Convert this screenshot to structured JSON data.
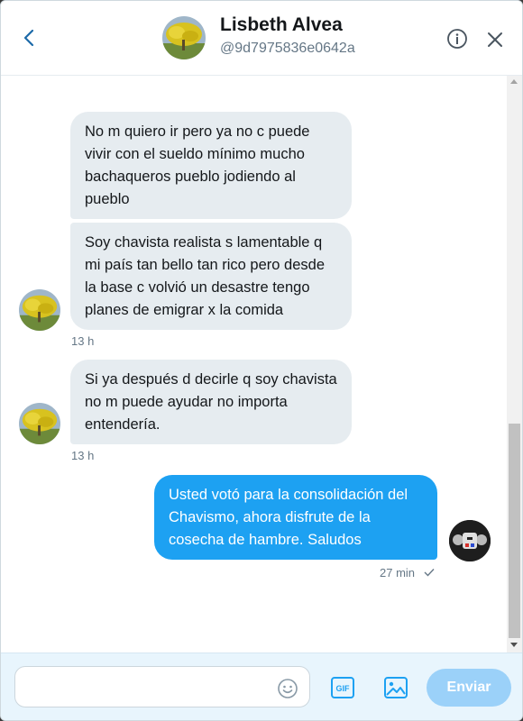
{
  "header": {
    "name": "Lisbeth Alvea",
    "handle": "@9d7975836e0642a",
    "back_icon": "chevron-left-icon",
    "info_icon": "info-icon",
    "close_icon": "close-icon"
  },
  "messages": [
    {
      "direction": "in",
      "text": "No m quiero ir pero ya no c puede vivir con el sueldo mínimo mucho bachaqueros pueblo jodiendo al pueblo"
    },
    {
      "direction": "in",
      "text": "Soy chavista realista s lamentable q mi país tan bello tan rico pero desde la base c volvió un desastre tengo planes de emigrar x la comida",
      "timestamp": "13 h"
    },
    {
      "direction": "in",
      "text": "Si ya después d decirle q soy chavista no m puede ayudar no importa entendería.",
      "timestamp": "13 h"
    },
    {
      "direction": "out",
      "text": "Usted votó para la consolidación del Chavismo, ahora disfrute de la cosecha de hambre. Saludos",
      "timestamp": "27 min",
      "status_icon": "checkmark-icon"
    }
  ],
  "composer": {
    "placeholder": "",
    "send_label": "Enviar",
    "gif_label": "GIF"
  },
  "colors": {
    "accent": "#1da1f2",
    "incoming_bubble": "#e6ecf0",
    "send_disabled": "#9bd1f9"
  }
}
